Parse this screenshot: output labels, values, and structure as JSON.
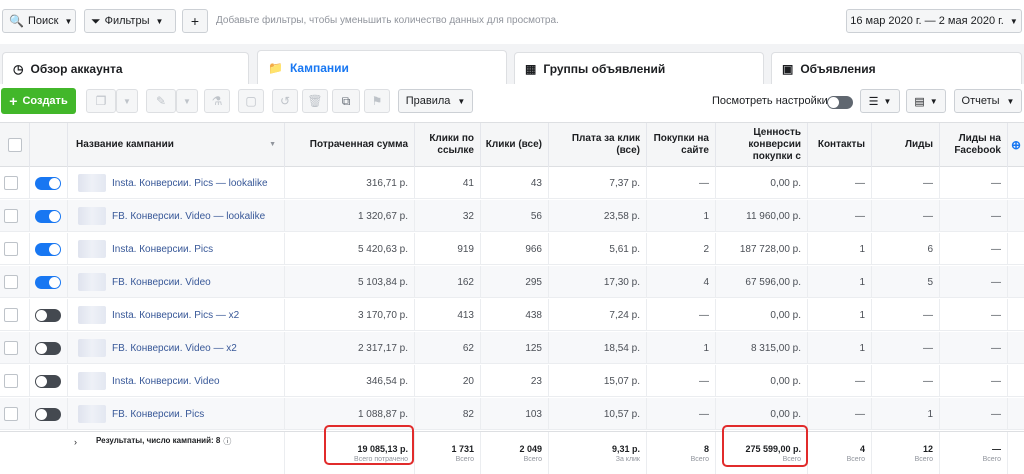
{
  "topbar": {
    "search_label": "Поиск",
    "filters_label": "Фильтры",
    "add_label": "+",
    "hint": "Добавьте фильтры, чтобы уменьшить количество данных для просмотра.",
    "date_range": "16 мар 2020 г. — 2 мая 2020 г."
  },
  "tabs": [
    {
      "label": "Обзор аккаунта",
      "icon": "dashboard-icon"
    },
    {
      "label": "Кампании",
      "icon": "folder-icon"
    },
    {
      "label": "Группы объявлений",
      "icon": "grid-icon"
    },
    {
      "label": "Объявления",
      "icon": "ad-icon"
    }
  ],
  "toolbar": {
    "create_label": "Создать",
    "rules_label": "Правила",
    "settings_label": "Посмотреть настройки",
    "reports_label": "Отчеты"
  },
  "columns": [
    "Название кампании",
    "Потраченная сумма",
    "Клики по ссылке",
    "Клики (все)",
    "Плата за клик (все)",
    "Покупки на сайте",
    "Ценность конверсии покупки с",
    "Контакты",
    "Лиды",
    "Лиды на Facebook"
  ],
  "rows": [
    {
      "name": "Insta. Конверсии. Pics — lookalike",
      "on": true,
      "spent": "316,71 р.",
      "link_clicks": "41",
      "clicks": "43",
      "cpc": "7,37 р.",
      "purchases": "—",
      "value": "0,00 р.",
      "contacts": "—",
      "leads": "—",
      "fb_leads": "—"
    },
    {
      "name": "FB. Конверсии. Video — lookalike",
      "on": true,
      "spent": "1 320,67 р.",
      "link_clicks": "32",
      "clicks": "56",
      "cpc": "23,58 р.",
      "purchases": "1",
      "value": "11 960,00 р.",
      "contacts": "—",
      "leads": "—",
      "fb_leads": "—"
    },
    {
      "name": "Insta. Конверсии. Pics",
      "on": true,
      "spent": "5 420,63 р.",
      "link_clicks": "919",
      "clicks": "966",
      "cpc": "5,61 р.",
      "purchases": "2",
      "value": "187 728,00 р.",
      "contacts": "1",
      "leads": "6",
      "fb_leads": "—"
    },
    {
      "name": "FB. Конверсии. Video",
      "on": true,
      "spent": "5 103,84 р.",
      "link_clicks": "162",
      "clicks": "295",
      "cpc": "17,30 р.",
      "purchases": "4",
      "value": "67 596,00 р.",
      "contacts": "1",
      "leads": "5",
      "fb_leads": "—"
    },
    {
      "name": "Insta. Конверсии. Pics — x2",
      "on": false,
      "spent": "3 170,70 р.",
      "link_clicks": "413",
      "clicks": "438",
      "cpc": "7,24 р.",
      "purchases": "—",
      "value": "0,00 р.",
      "contacts": "1",
      "leads": "—",
      "fb_leads": "—"
    },
    {
      "name": "FB. Конверсии. Video — x2",
      "on": false,
      "spent": "2 317,17 р.",
      "link_clicks": "62",
      "clicks": "125",
      "cpc": "18,54 р.",
      "purchases": "1",
      "value": "8 315,00 р.",
      "contacts": "1",
      "leads": "—",
      "fb_leads": "—"
    },
    {
      "name": "Insta. Конверсии. Video",
      "on": false,
      "spent": "346,54 р.",
      "link_clicks": "20",
      "clicks": "23",
      "cpc": "15,07 р.",
      "purchases": "—",
      "value": "0,00 р.",
      "contacts": "—",
      "leads": "—",
      "fb_leads": "—"
    },
    {
      "name": "FB. Конверсии. Pics",
      "on": false,
      "spent": "1 088,87 р.",
      "link_clicks": "82",
      "clicks": "103",
      "cpc": "10,57 р.",
      "purchases": "—",
      "value": "0,00 р.",
      "contacts": "—",
      "leads": "1",
      "fb_leads": "—"
    }
  ],
  "summary": {
    "label": "Результаты, число кампаний: 8",
    "spent": "19 085,13 р.",
    "spent_sub": "Всего потрачено",
    "link_clicks": "1 731",
    "link_clicks_sub": "Всего",
    "clicks": "2 049",
    "clicks_sub": "Всего",
    "cpc": "9,31 р.",
    "cpc_sub": "За клик",
    "purchases": "8",
    "purchases_sub": "Всего",
    "value": "275 599,00 р.",
    "value_sub": "Всего",
    "contacts": "4",
    "contacts_sub": "Всего",
    "leads": "12",
    "leads_sub": "Всего",
    "fb_leads": "—",
    "fb_leads_sub": "Всего"
  },
  "colors": {
    "accent": "#1877f2",
    "create": "#42b72a",
    "highlight": "#e12b2b"
  }
}
